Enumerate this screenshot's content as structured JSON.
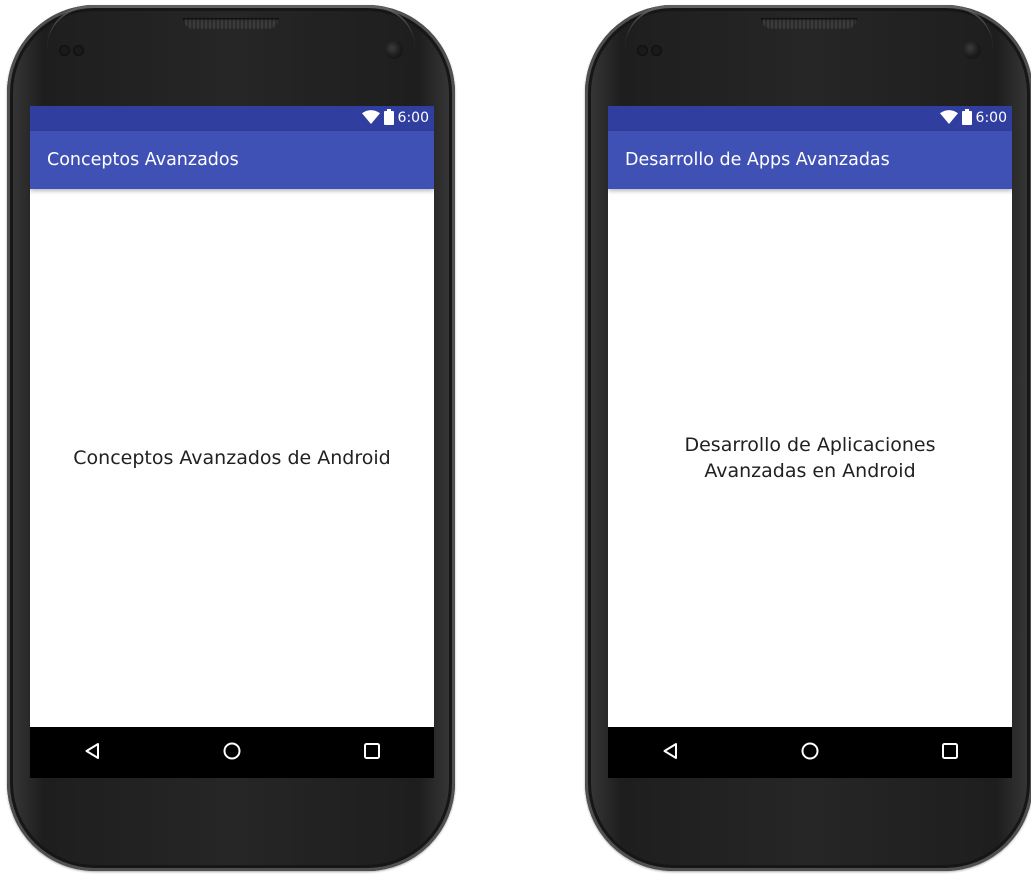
{
  "colors": {
    "status_bar": "#303f9f",
    "app_bar": "#3f51b5",
    "nav_bar": "#000000",
    "screen_bg": "#ffffff",
    "text_primary": "#212121"
  },
  "phones": [
    {
      "status": {
        "wifi_icon": "wifi-icon",
        "battery_icon": "battery-icon",
        "time": "6:00"
      },
      "app_bar": {
        "title": "Conceptos Avanzados"
      },
      "content": {
        "text": "Conceptos Avanzados de Android"
      },
      "nav": {
        "back_icon": "back-triangle-icon",
        "home_icon": "home-circle-icon",
        "recents_icon": "recents-square-icon"
      }
    },
    {
      "status": {
        "wifi_icon": "wifi-icon",
        "battery_icon": "battery-icon",
        "time": "6:00"
      },
      "app_bar": {
        "title": "Desarrollo de Apps Avanzadas"
      },
      "content": {
        "line1": "Desarrollo de Aplicaciones",
        "line2": "Avanzadas en Android"
      },
      "nav": {
        "back_icon": "back-triangle-icon",
        "home_icon": "home-circle-icon",
        "recents_icon": "recents-square-icon"
      }
    }
  ]
}
